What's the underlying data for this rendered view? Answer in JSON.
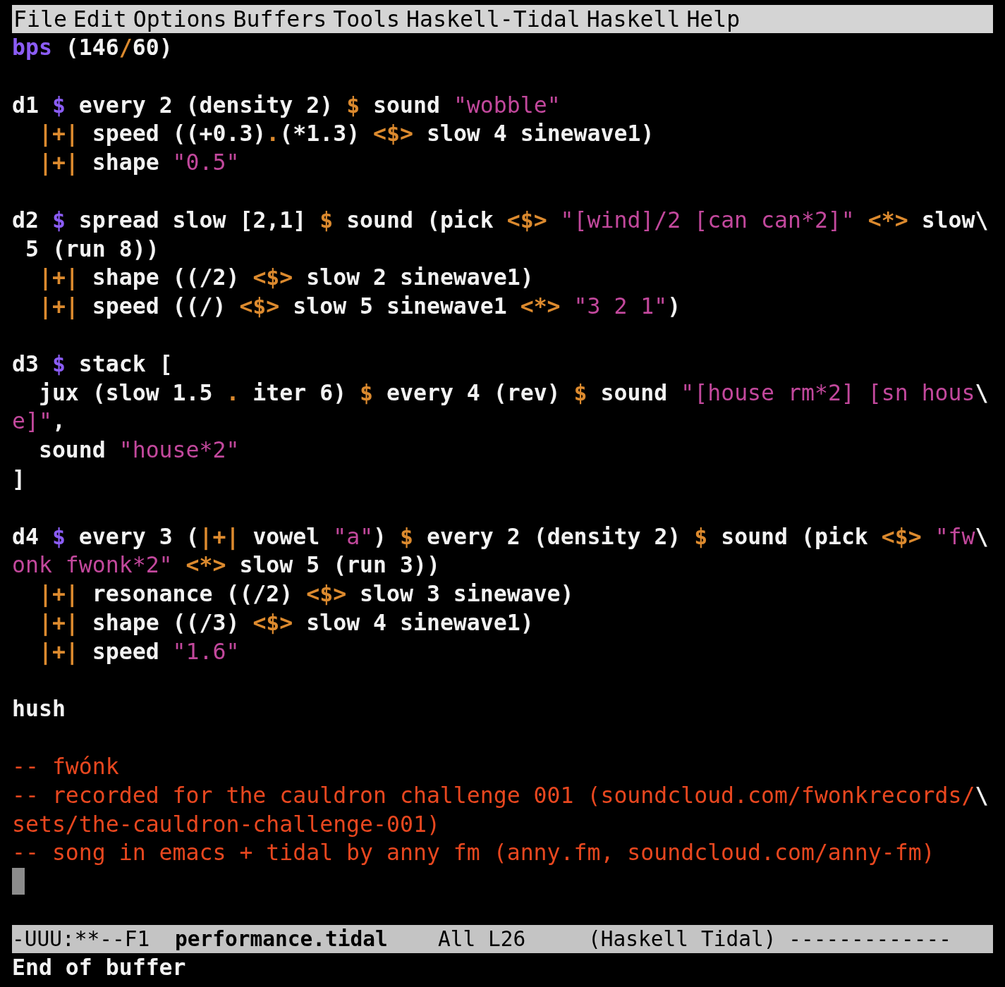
{
  "menu_bar": [
    "File",
    "Edit",
    "Options",
    "Buffers",
    "Tools",
    "Haskell-Tidal",
    "Haskell",
    "Help"
  ],
  "buffer_lines": [
    {
      "kind": "code",
      "parts": [
        {
          "kind": "keyword",
          "text": "bps"
        },
        {
          "kind": "plain",
          "text": " (146"
        },
        {
          "kind": "operator",
          "text": "/"
        },
        {
          "kind": "plain",
          "text": "60)"
        }
      ]
    },
    {
      "kind": "blank"
    },
    {
      "kind": "code",
      "parts": [
        {
          "kind": "plain",
          "text": "d1 "
        },
        {
          "kind": "keyword",
          "text": "$"
        },
        {
          "kind": "plain",
          "text": " every 2 (density 2) "
        },
        {
          "kind": "operator",
          "text": "$"
        },
        {
          "kind": "plain",
          "text": " sound "
        },
        {
          "kind": "string",
          "text": "\"wobble\""
        }
      ]
    },
    {
      "kind": "code",
      "parts": [
        {
          "kind": "operator",
          "text": "  |+|"
        },
        {
          "kind": "plain",
          "text": " speed ((+0.3)"
        },
        {
          "kind": "operator",
          "text": "."
        },
        {
          "kind": "plain",
          "text": "(*1.3) "
        },
        {
          "kind": "operator",
          "text": "<$>"
        },
        {
          "kind": "plain",
          "text": " slow 4 sinewave1)"
        }
      ]
    },
    {
      "kind": "code",
      "parts": [
        {
          "kind": "operator",
          "text": "  |+|"
        },
        {
          "kind": "plain",
          "text": " shape "
        },
        {
          "kind": "string",
          "text": "\"0.5\""
        }
      ]
    },
    {
      "kind": "blank"
    },
    {
      "kind": "code",
      "parts": [
        {
          "kind": "plain",
          "text": "d2 "
        },
        {
          "kind": "keyword",
          "text": "$"
        },
        {
          "kind": "plain",
          "text": " spread slow [2,1] "
        },
        {
          "kind": "operator",
          "text": "$"
        },
        {
          "kind": "plain",
          "text": " sound (pick "
        },
        {
          "kind": "operator",
          "text": "<$> "
        },
        {
          "kind": "string",
          "text": "\"[wind]/2 [can can*2]\" "
        },
        {
          "kind": "operator",
          "text": "<*>"
        },
        {
          "kind": "plain",
          "text": " slow\\"
        }
      ]
    },
    {
      "kind": "code",
      "parts": [
        {
          "kind": "plain",
          "text": " 5 (run 8))"
        }
      ]
    },
    {
      "kind": "code",
      "parts": [
        {
          "kind": "operator",
          "text": "  |+|"
        },
        {
          "kind": "plain",
          "text": " shape ((/2) "
        },
        {
          "kind": "operator",
          "text": "<$>"
        },
        {
          "kind": "plain",
          "text": " slow 2 sinewave1)"
        }
      ]
    },
    {
      "kind": "code",
      "parts": [
        {
          "kind": "operator",
          "text": "  |+|"
        },
        {
          "kind": "plain",
          "text": " speed ((/) "
        },
        {
          "kind": "operator",
          "text": "<$>"
        },
        {
          "kind": "plain",
          "text": " slow 5 sinewave1 "
        },
        {
          "kind": "operator",
          "text": "<*> "
        },
        {
          "kind": "string",
          "text": "\"3 2 1\""
        },
        {
          "kind": "plain",
          "text": ")"
        }
      ]
    },
    {
      "kind": "blank"
    },
    {
      "kind": "code",
      "parts": [
        {
          "kind": "plain",
          "text": "d3 "
        },
        {
          "kind": "keyword",
          "text": "$"
        },
        {
          "kind": "plain",
          "text": " stack ["
        }
      ]
    },
    {
      "kind": "code",
      "parts": [
        {
          "kind": "plain",
          "text": "  jux (slow 1.5 "
        },
        {
          "kind": "operator",
          "text": "."
        },
        {
          "kind": "plain",
          "text": " iter 6) "
        },
        {
          "kind": "operator",
          "text": "$"
        },
        {
          "kind": "plain",
          "text": " every 4 (rev) "
        },
        {
          "kind": "operator",
          "text": "$"
        },
        {
          "kind": "plain",
          "text": " sound "
        },
        {
          "kind": "string",
          "text": "\"[house rm*2] [sn hous"
        },
        {
          "kind": "plain",
          "text": "\\"
        }
      ]
    },
    {
      "kind": "code",
      "parts": [
        {
          "kind": "string",
          "text": "e]\""
        },
        {
          "kind": "plain",
          "text": ","
        }
      ]
    },
    {
      "kind": "code",
      "parts": [
        {
          "kind": "plain",
          "text": "  sound "
        },
        {
          "kind": "string",
          "text": "\"house*2\""
        }
      ]
    },
    {
      "kind": "code",
      "parts": [
        {
          "kind": "plain",
          "text": "]"
        }
      ]
    },
    {
      "kind": "blank"
    },
    {
      "kind": "code",
      "parts": [
        {
          "kind": "plain",
          "text": "d4 "
        },
        {
          "kind": "keyword",
          "text": "$"
        },
        {
          "kind": "plain",
          "text": " every 3 ("
        },
        {
          "kind": "operator",
          "text": "|+|"
        },
        {
          "kind": "plain",
          "text": " vowel "
        },
        {
          "kind": "string",
          "text": "\"a\""
        },
        {
          "kind": "plain",
          "text": ") "
        },
        {
          "kind": "operator",
          "text": "$"
        },
        {
          "kind": "plain",
          "text": " every 2 (density 2) "
        },
        {
          "kind": "operator",
          "text": "$"
        },
        {
          "kind": "plain",
          "text": " sound (pick "
        },
        {
          "kind": "operator",
          "text": "<$> "
        },
        {
          "kind": "string",
          "text": "\"fw"
        },
        {
          "kind": "plain",
          "text": "\\"
        }
      ]
    },
    {
      "kind": "code",
      "parts": [
        {
          "kind": "string",
          "text": "onk fwonk*2\" "
        },
        {
          "kind": "operator",
          "text": "<*>"
        },
        {
          "kind": "plain",
          "text": " slow 5 (run 3))"
        }
      ]
    },
    {
      "kind": "code",
      "parts": [
        {
          "kind": "operator",
          "text": "  |+|"
        },
        {
          "kind": "plain",
          "text": " resonance ((/2) "
        },
        {
          "kind": "operator",
          "text": "<$>"
        },
        {
          "kind": "plain",
          "text": " slow 3 sinewave)"
        }
      ]
    },
    {
      "kind": "code",
      "parts": [
        {
          "kind": "operator",
          "text": "  |+|"
        },
        {
          "kind": "plain",
          "text": " shape ((/3) "
        },
        {
          "kind": "operator",
          "text": "<$>"
        },
        {
          "kind": "plain",
          "text": " slow 4 sinewave1)"
        }
      ]
    },
    {
      "kind": "code",
      "parts": [
        {
          "kind": "operator",
          "text": "  |+|"
        },
        {
          "kind": "plain",
          "text": " speed "
        },
        {
          "kind": "string",
          "text": "\"1.6\""
        }
      ]
    },
    {
      "kind": "blank"
    },
    {
      "kind": "code",
      "parts": [
        {
          "kind": "plain",
          "text": "hush"
        }
      ]
    },
    {
      "kind": "blank"
    },
    {
      "kind": "code",
      "parts": [
        {
          "kind": "comment",
          "text": "-- fwónk"
        }
      ]
    },
    {
      "kind": "code",
      "parts": [
        {
          "kind": "comment",
          "text": "-- recorded for the cauldron challenge 001 (soundcloud.com/fwonkrecords/"
        },
        {
          "kind": "plain",
          "text": "\\"
        }
      ]
    },
    {
      "kind": "code",
      "parts": [
        {
          "kind": "comment",
          "text": "sets/the-cauldron-challenge-001)"
        }
      ]
    },
    {
      "kind": "code",
      "parts": [
        {
          "kind": "comment",
          "text": "-- song in emacs + tidal by anny fm (anny.fm, soundcloud.com/anny-fm)"
        }
      ]
    },
    {
      "kind": "cursor"
    },
    {
      "kind": "blank"
    }
  ],
  "mode_line": {
    "status": "-UUU:**--F1",
    "buffer_name": "performance.tidal",
    "position": "All L26",
    "major_mode": "(Haskell Tidal)",
    "fill": "-------------"
  },
  "echo_area": "End of buffer"
}
